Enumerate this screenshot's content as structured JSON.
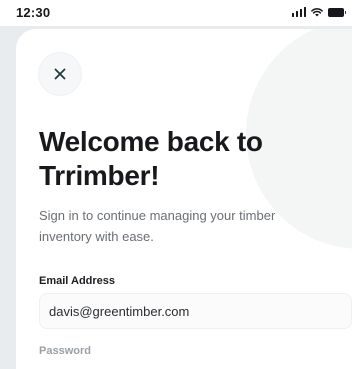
{
  "status_bar": {
    "time": "12:30",
    "icons": [
      "signal-icon",
      "wifi-icon",
      "battery-icon"
    ]
  },
  "login": {
    "close_icon": "close-icon",
    "title": "Welcome back to Trrimber!",
    "subtitle": "Sign in to continue managing your timber inventory with ease.",
    "email": {
      "label": "Email Address",
      "value": "davis@greentimber.com"
    },
    "next_field_label": "Password"
  },
  "colors": {
    "background": "#e9ecef",
    "sheet": "#ffffff",
    "title_text": "#17191c",
    "subtitle_text": "#6a6f75"
  }
}
